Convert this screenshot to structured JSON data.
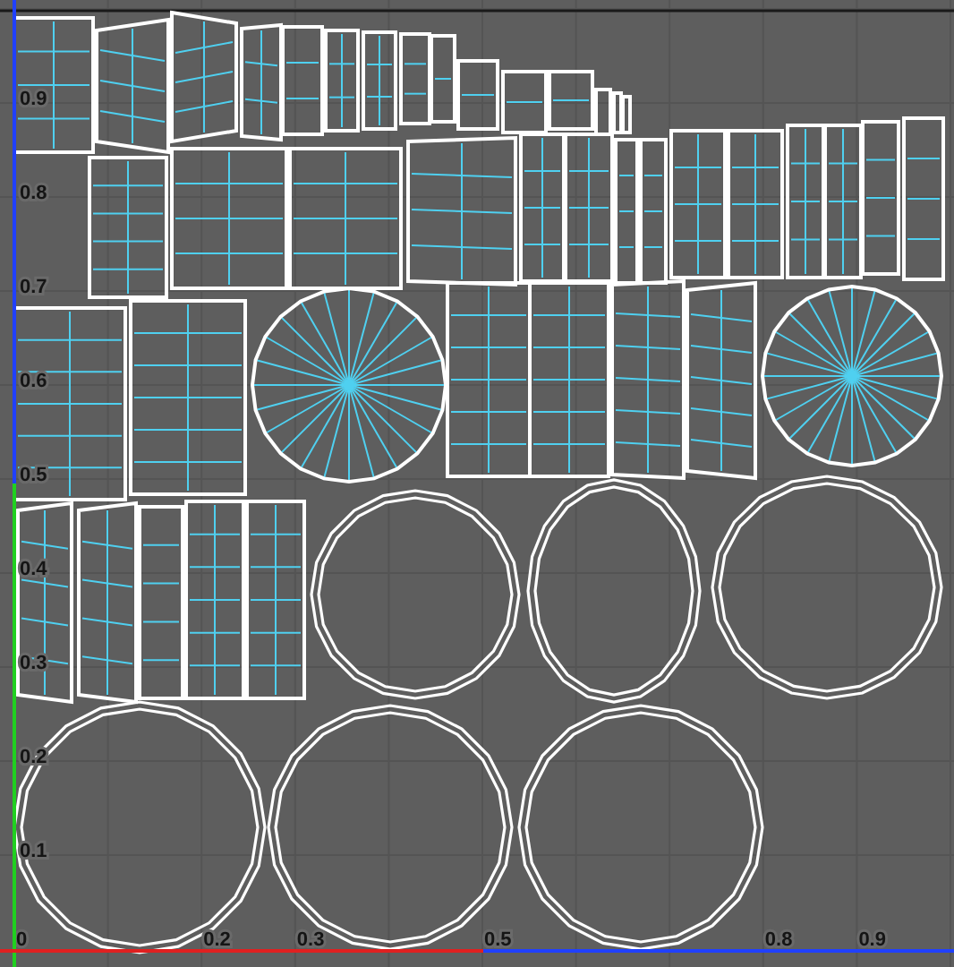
{
  "uv_editor": {
    "y_axis_labels": [
      "0.9",
      "0.8",
      "0.7",
      "0.6",
      "0.5",
      "0.4",
      "0.3",
      "0.2",
      "0.1"
    ],
    "x_axis_labels": [
      "0",
      "0.2",
      "0.3",
      "0.5",
      "0.8",
      "0.9"
    ]
  }
}
